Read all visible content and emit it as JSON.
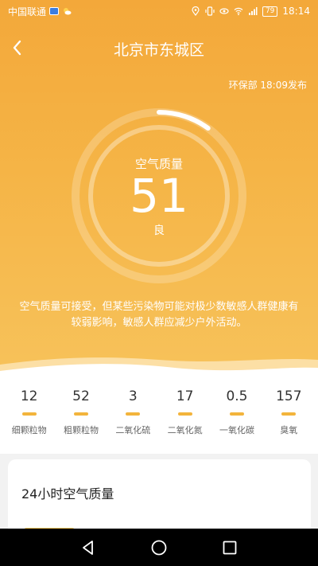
{
  "status_bar": {
    "carrier": "中国联通",
    "battery": "79",
    "time": "18:14",
    "icons": [
      "sim-hd-icon",
      "weather-icon",
      "location-icon",
      "vibrate-icon",
      "eye-icon",
      "wifi-icon",
      "signal-icon",
      "battery-icon"
    ]
  },
  "header": {
    "title": "北京市东城区",
    "publish": "环保部 18:09发布"
  },
  "aqi": {
    "label": "空气质量",
    "value": "51",
    "level": "良",
    "gauge_fraction": 0.1
  },
  "advice": "空气质量可接受，但某些污染物可能对极少数敏感人群健康有较弱影响，敏感人群应减少户外活动。",
  "pollutants": [
    {
      "value": "12",
      "name": "细颗粒物"
    },
    {
      "value": "52",
      "name": "粗颗粒物"
    },
    {
      "value": "3",
      "name": "二氧化硫"
    },
    {
      "value": "17",
      "name": "二氧化氮"
    },
    {
      "value": "0.5",
      "name": "一氧化碳"
    },
    {
      "value": "157",
      "name": "臭氧"
    }
  ],
  "card": {
    "title": "24小时空气质量"
  },
  "colors": {
    "hero_top": "#f3a83a",
    "hero_bottom": "#f7c25a",
    "accent_bar": "#f3b43c"
  }
}
